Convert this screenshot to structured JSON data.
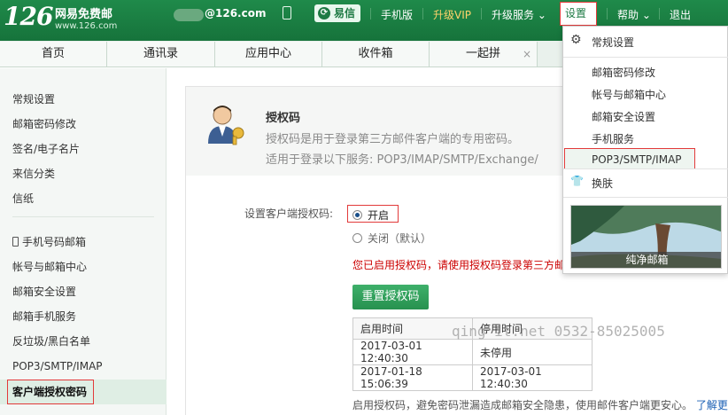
{
  "header": {
    "logo_number": "126",
    "logo_name": "网易免费邮",
    "logo_url": "www.126.com",
    "account_domain": "@126.com",
    "yixin_label": "易信",
    "mobile_label": "手机版",
    "vip_label": "升级VIP",
    "upgrade_label": "升级服务",
    "settings_label": "设置",
    "help_label": "帮助",
    "logout_label": "退出"
  },
  "tabs": [
    {
      "label": "首页"
    },
    {
      "label": "通讯录"
    },
    {
      "label": "应用中心"
    },
    {
      "label": "收件箱"
    },
    {
      "label": "一起拼"
    }
  ],
  "tab_close_glyph": "×",
  "sidebar": {
    "items": [
      "常规设置",
      "邮箱密码修改",
      "签名/电子名片",
      "来信分类",
      "信纸",
      "手机号码邮箱",
      "帐号与邮箱中心",
      "邮箱安全设置",
      "邮箱手机服务",
      "反垃圾/黑白名单",
      "POP3/SMTP/IMAP",
      "客户端授权密码"
    ]
  },
  "auth": {
    "title": "授权码",
    "desc1": "授权码是用于登录第三方邮件客户端的专用密码。",
    "desc2": "适用于登录以下服务: POP3/IMAP/SMTP/Exchange/",
    "form_label": "设置客户端授权码:",
    "on_label": "开启",
    "off_label": "关闭（默认）",
    "warning": "您已启用授权码，请使用授权码登录第三方邮",
    "reset_button": "重置授权码",
    "table_headers": [
      "启用时间",
      "停用时间"
    ],
    "table_rows": [
      [
        "2017-03-01 12:40:30",
        "未停用"
      ],
      [
        "2017-01-18 15:06:39",
        "2017-03-01 12:40:30"
      ]
    ],
    "footnote": "启用授权码，避免密码泄漏造成邮箱安全隐患，使用邮件客户端更安心。",
    "footnote_link": "了解更多"
  },
  "watermark": "qing        it.net  0532-85025005",
  "settings_menu": {
    "general": "常规设置",
    "items": [
      "邮箱密码修改",
      "帐号与邮箱中心",
      "邮箱安全设置",
      "手机服务",
      "POP3/SMTP/IMAP"
    ],
    "skin": "换肤",
    "skin_caption": "纯净邮箱"
  },
  "colors": {
    "brand_green": "#1e7a44",
    "highlight_red": "#e23a3a",
    "warning_red": "#cc0000",
    "link_blue": "#1a5fb4"
  }
}
